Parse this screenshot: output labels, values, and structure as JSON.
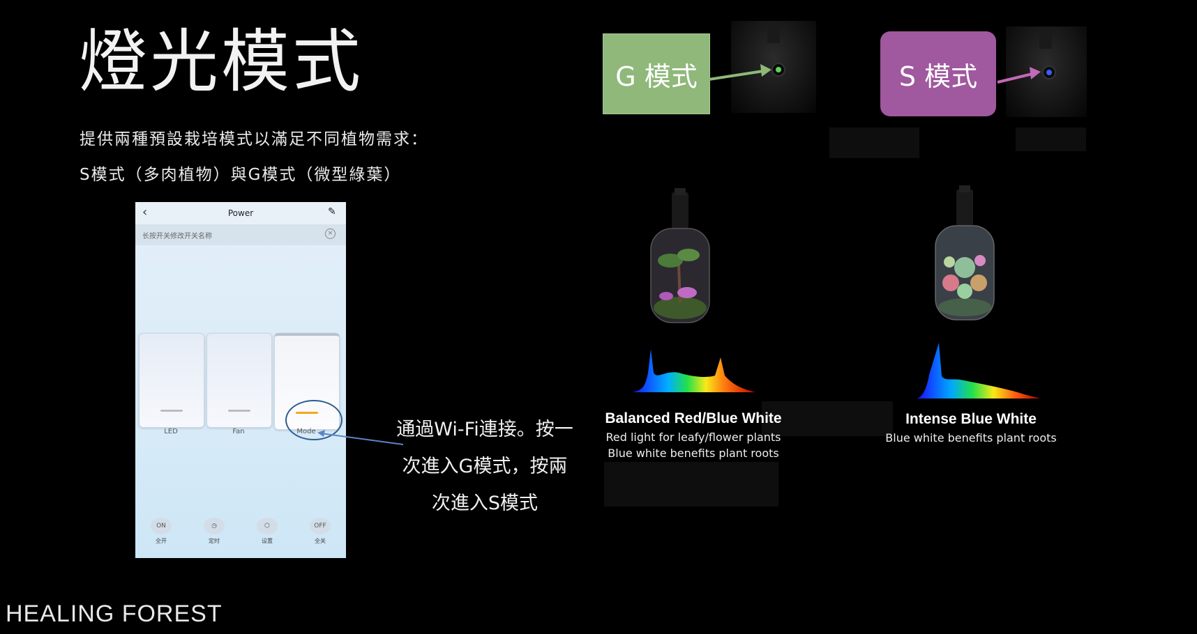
{
  "title": "燈光模式",
  "subtitle_line1": "提供兩種預設栽培模式以滿足不同植物需求：",
  "subtitle_line2": "S模式（多肉植物）與G模式（微型綠葉）",
  "brand": "HEALING FOREST",
  "phone": {
    "back_icon": "chevron-left-icon",
    "title": "Power",
    "edit_icon": "pencil-icon",
    "hint": "长按开关修改开关名称",
    "switches": [
      {
        "label": "LED"
      },
      {
        "label": "Fan"
      },
      {
        "label": "Mode"
      }
    ],
    "bottom": [
      {
        "icon": "ON",
        "label": "全开"
      },
      {
        "icon": "clock-icon",
        "label": "定时"
      },
      {
        "icon": "settings-icon",
        "label": "设置"
      },
      {
        "icon": "OFF",
        "label": "全关"
      }
    ]
  },
  "instruction_line1": "通過Wi-Fi連接。按一",
  "instruction_line2": "次進入G模式，按兩",
  "instruction_line3": "次進入S模式",
  "g_mode": {
    "label": "G 模式",
    "color": "#8fb87a",
    "indicator": "#5ad35a"
  },
  "s_mode": {
    "label": "S 模式",
    "color": "#a0589e",
    "indicator": "#3a5bff"
  },
  "left_caption": {
    "title": "Balanced Red/Blue White",
    "line1": "Red light for leafy/flower plants",
    "line2": "Blue white benefits plant roots"
  },
  "right_caption": {
    "title": "Intense Blue White",
    "line1": "Blue white benefits plant roots"
  }
}
